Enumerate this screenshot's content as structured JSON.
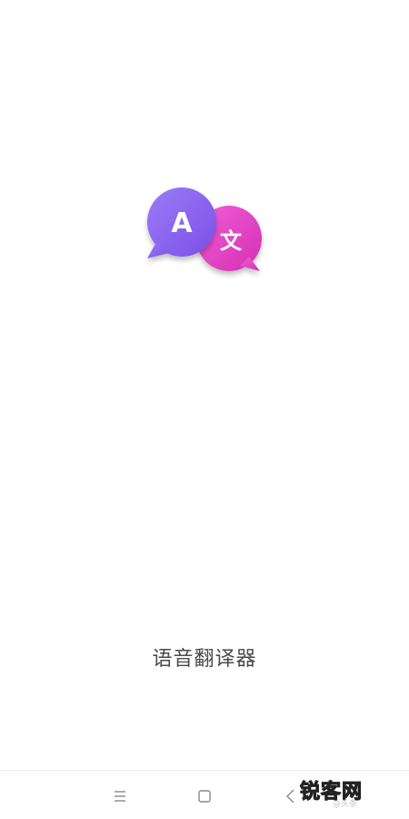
{
  "app": {
    "name": "语音翻译器",
    "logo": {
      "left_glyph": "A",
      "right_glyph": "文",
      "left_color": "#8a66f0",
      "right_color": "#e23ec3"
    }
  },
  "nav_bar": {
    "menu_icon": "menu-lines-icon",
    "home_icon": "home-square-icon",
    "back_icon": "back-chevron-icon"
  },
  "watermark": {
    "title": "锐客网",
    "subtitle": "@头条"
  }
}
